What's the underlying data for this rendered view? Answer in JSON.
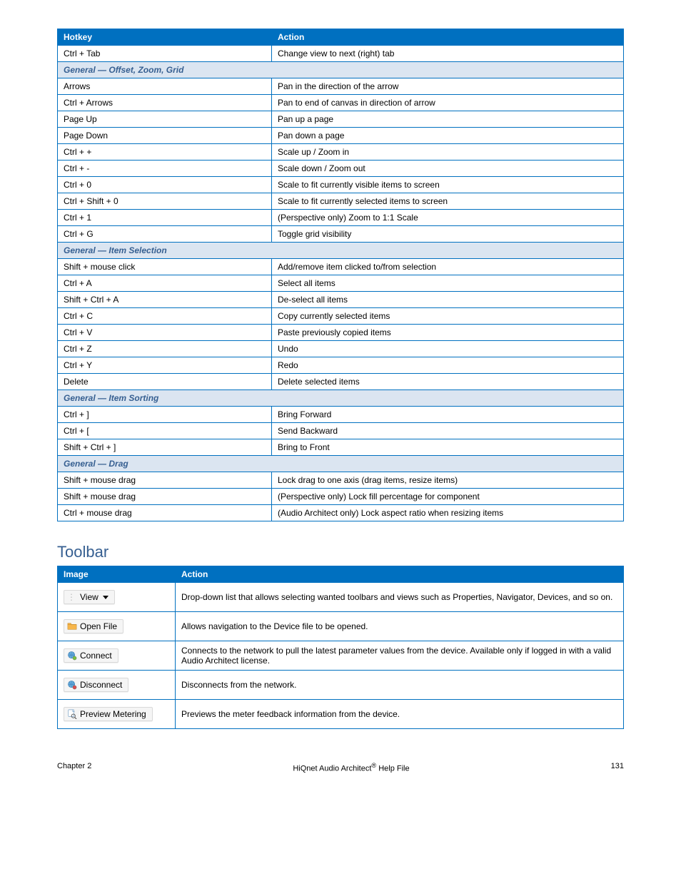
{
  "table1": {
    "header": [
      "Hotkey",
      "Action"
    ],
    "rows": [
      {
        "k": "Ctrl + Tab",
        "a": "Change view to next (right) tab"
      },
      {
        "section": "General — Offset, Zoom, Grid"
      },
      {
        "k": "Arrows",
        "a": "Pan in the direction of the arrow"
      },
      {
        "k": "Ctrl + Arrows",
        "a": "Pan to end of canvas in direction of arrow"
      },
      {
        "k": "Page Up",
        "a": "Pan up a page"
      },
      {
        "k": "Page Down",
        "a": "Pan down a page"
      },
      {
        "k": "Ctrl + +",
        "a": "Scale up / Zoom in"
      },
      {
        "k": "Ctrl + -",
        "a": "Scale down / Zoom out"
      },
      {
        "k": "Ctrl + 0",
        "a": "Scale to fit currently visible items to screen"
      },
      {
        "k": "Ctrl + Shift + 0",
        "a": "Scale to fit currently selected items to screen"
      },
      {
        "k": "Ctrl + 1",
        "a": "(Perspective only) Zoom to 1:1 Scale"
      },
      {
        "k": "Ctrl + G",
        "a": "Toggle grid visibility"
      },
      {
        "section": "General — Item Selection"
      },
      {
        "k": "Shift + mouse click",
        "a": "Add/remove item clicked to/from selection"
      },
      {
        "k": "Ctrl + A",
        "a": "Select all items"
      },
      {
        "k": "Shift + Ctrl + A",
        "a": "De-select all items"
      },
      {
        "k": "Ctrl + C",
        "a": "Copy currently selected items"
      },
      {
        "k": "Ctrl + V",
        "a": "Paste previously copied items"
      },
      {
        "k": "Ctrl + Z",
        "a": "Undo"
      },
      {
        "k": "Ctrl + Y",
        "a": "Redo"
      },
      {
        "k": "Delete",
        "a": "Delete selected items"
      },
      {
        "section": "General — Item Sorting"
      },
      {
        "k": "Ctrl + ]",
        "a": "Bring Forward"
      },
      {
        "k": "Ctrl + [",
        "a": "Send Backward"
      },
      {
        "k": "Shift + Ctrl + ]",
        "a": "Bring to Front"
      },
      {
        "section": "General — Drag"
      },
      {
        "k": "Shift + mouse drag",
        "a": "Lock drag to one axis (drag items, resize items)"
      },
      {
        "k": "Shift + mouse drag",
        "a": "(Perspective only) Lock fill percentage for component"
      },
      {
        "k": "Ctrl + mouse drag",
        "a": "(Audio Architect only) Lock aspect ratio when resizing items"
      }
    ]
  },
  "section_title": "Toolbar",
  "table2": {
    "header": [
      "Image",
      "Action"
    ],
    "rows": [
      {
        "btn": "view",
        "label": "View",
        "desc": "Drop-down list that allows selecting wanted toolbars and views such as Properties, Navigator, Devices, and so on."
      },
      {
        "btn": "openfile",
        "label": "Open File",
        "desc": "Allows navigation to the Device file to be opened."
      },
      {
        "btn": "connect",
        "label": "Connect",
        "desc": "Connects to the network to pull the latest parameter values from the device. Available only if logged in with a valid Audio Architect license."
      },
      {
        "btn": "disconnect",
        "label": "Disconnect",
        "desc": "Disconnects from the network."
      },
      {
        "btn": "preview",
        "label": "Preview Metering",
        "desc": "Previews the meter feedback information from the device."
      }
    ]
  },
  "footer": {
    "left": "Chapter 2",
    "center_prefix": "HiQnet Audio Architect",
    "center_suffix": " Help File",
    "page": "131"
  }
}
